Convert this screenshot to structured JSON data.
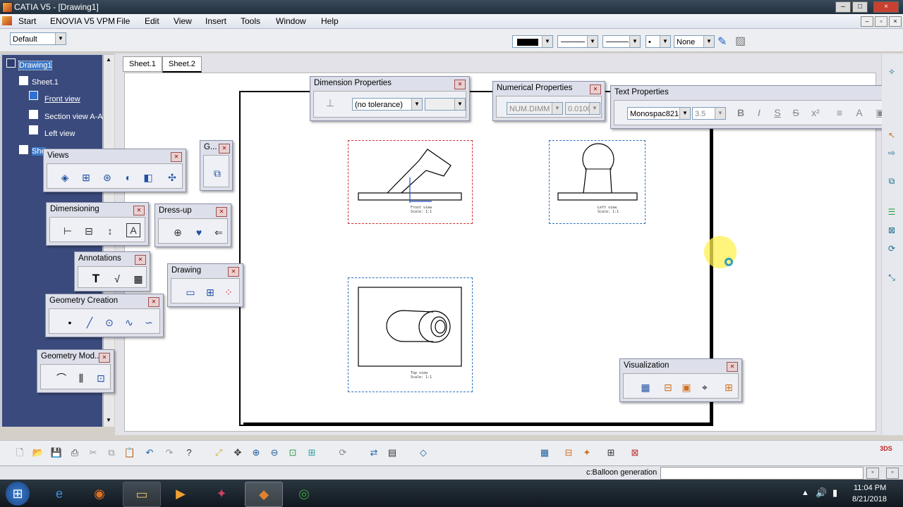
{
  "window": {
    "title": "CATIA V5 - [Drawing1]",
    "minimize": "–",
    "maximize": "□",
    "close": "×"
  },
  "menu": {
    "start": "Start",
    "enovia": "ENOVIA V5 VPM",
    "file": "File",
    "edit": "Edit",
    "view": "View",
    "insert": "Insert",
    "tools": "Tools",
    "window": "Window",
    "help": "Help"
  },
  "toolbar": {
    "style_combo": "Default",
    "line_end": "None",
    "dot": "•"
  },
  "tree": {
    "root": "Drawing1",
    "sheet": "Sheet.1",
    "front_view": "Front view",
    "section_view": "Section view A-A",
    "left_view": "Left view",
    "sheet2_partial": "She"
  },
  "tabs": [
    "Sheet.1",
    "Sheet.2"
  ],
  "panels": {
    "dimension_properties": {
      "title": "Dimension Properties",
      "tolerance": "(no tolerance)"
    },
    "numerical_properties": {
      "title": "Numerical Properties",
      "format": "NUM.DIMM",
      "precision": "0.0100"
    },
    "text_properties": {
      "title": "Text Properties",
      "font": "Monospac821",
      "size": "3.5"
    },
    "views": {
      "title": "Views"
    },
    "g": {
      "title": "G..."
    },
    "dimensioning": {
      "title": "Dimensioning"
    },
    "dressup": {
      "title": "Dress-up"
    },
    "annotations": {
      "title": "Annotations"
    },
    "drawing": {
      "title": "Drawing"
    },
    "geometry_creation": {
      "title": "Geometry Creation"
    },
    "geometry_modification": {
      "title": "Geometry Mod..."
    },
    "visualization": {
      "title": "Visualization"
    }
  },
  "views_on_sheet": {
    "front": {
      "label": "Front view",
      "scale": "Scale:  1:1"
    },
    "left": {
      "label": "Left view",
      "scale": "Scale:  1:1"
    },
    "top": {
      "label": "Top view",
      "scale": "Scale:  1:1"
    }
  },
  "status": {
    "prompt": "c:Balloon generation"
  },
  "taskbar": {
    "time": "11:04 PM",
    "date": "8/21/2018"
  },
  "colors": {
    "tree_bg": "#3a4a7c",
    "front_frame": "#d03030",
    "view_frame": "#3070c0",
    "accent": "#2050a0"
  }
}
